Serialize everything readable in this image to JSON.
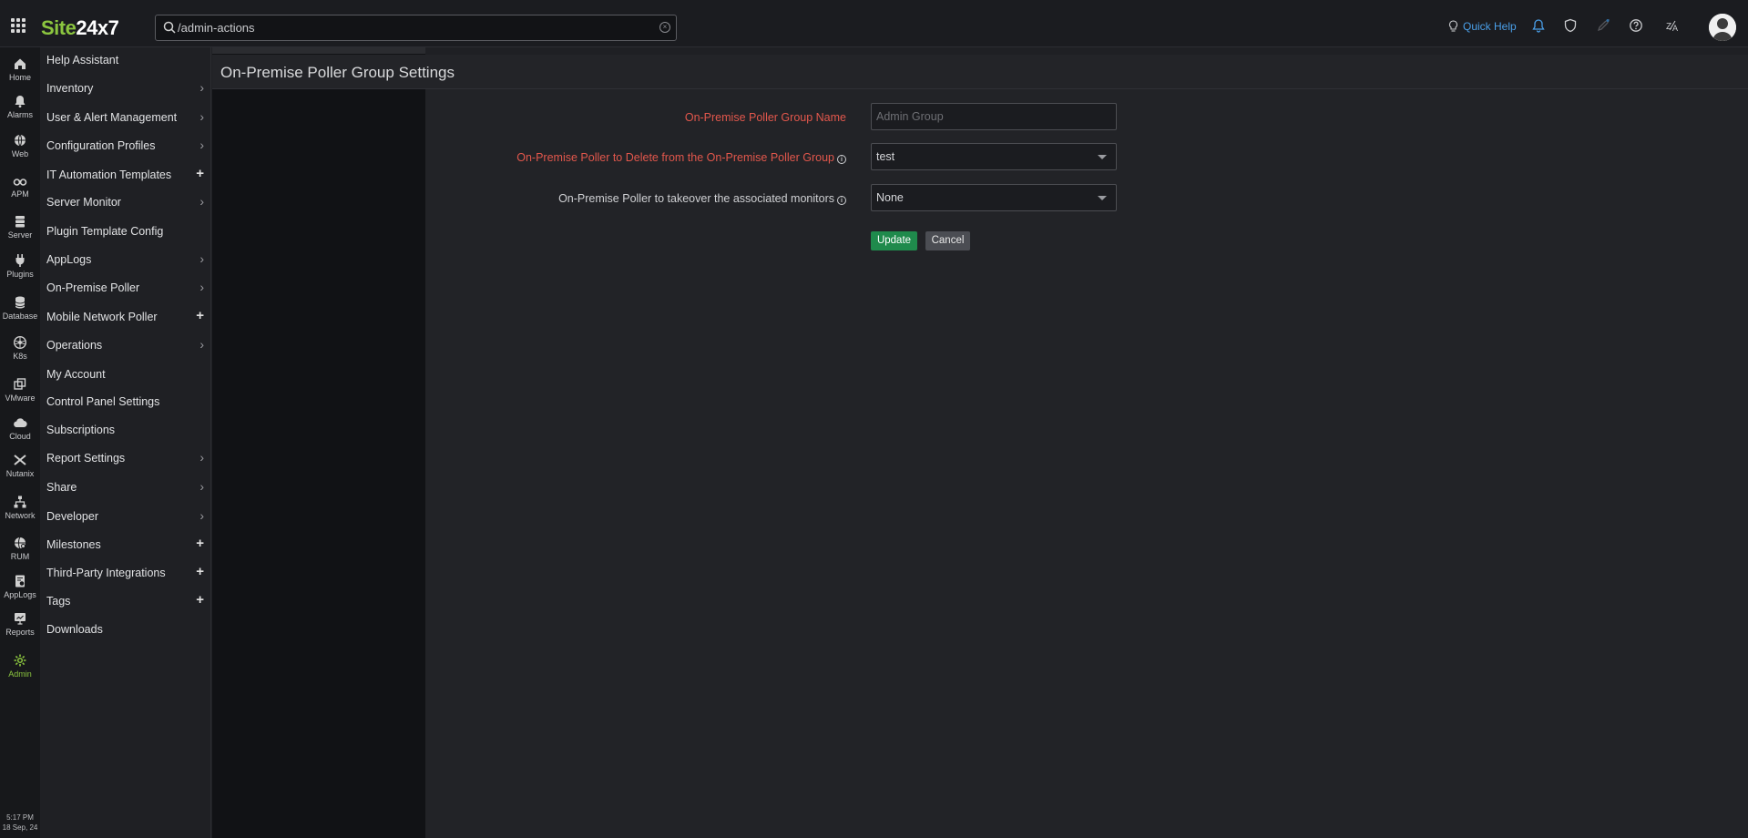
{
  "header": {
    "logo_part1": "Site",
    "logo_part2": "24x7",
    "search_value": "/admin-actions",
    "quick_help": "Quick Help",
    "icons": [
      "apps-grid-icon",
      "search-icon",
      "clear-icon",
      "lightbulb-icon",
      "bell-icon",
      "shield-icon",
      "rocket-icon",
      "help-icon",
      "translate-icon",
      "avatar"
    ]
  },
  "rail": {
    "items": [
      {
        "label": "Home",
        "icon": "home-icon"
      },
      {
        "label": "Alarms",
        "icon": "bell-icon"
      },
      {
        "label": "Web",
        "icon": "globe-icon"
      },
      {
        "label": "APM",
        "icon": "binoculars-icon"
      },
      {
        "label": "Server",
        "icon": "server-icon"
      },
      {
        "label": "Plugins",
        "icon": "plug-icon"
      },
      {
        "label": "Database",
        "icon": "database-icon"
      },
      {
        "label": "K8s",
        "icon": "kubernetes-icon"
      },
      {
        "label": "VMware",
        "icon": "vmware-icon"
      },
      {
        "label": "Cloud",
        "icon": "cloud-icon"
      },
      {
        "label": "Nutanix",
        "icon": "nutanix-icon"
      },
      {
        "label": "Network",
        "icon": "network-icon"
      },
      {
        "label": "RUM",
        "icon": "rum-icon"
      },
      {
        "label": "AppLogs",
        "icon": "applogs-icon"
      },
      {
        "label": "Reports",
        "icon": "reports-icon"
      },
      {
        "label": "Admin",
        "icon": "gear-icon"
      }
    ],
    "time": "5:17 PM",
    "date": "18 Sep, 24"
  },
  "menu": {
    "items": [
      {
        "label": "Help Assistant",
        "mark": ""
      },
      {
        "label": "Inventory",
        "mark": ">"
      },
      {
        "label": "User & Alert Management",
        "mark": ">"
      },
      {
        "label": "Configuration Profiles",
        "mark": ">"
      },
      {
        "label": "IT Automation Templates",
        "mark": "+"
      },
      {
        "label": "Server Monitor",
        "mark": ">"
      },
      {
        "label": "Plugin Template Config",
        "mark": ""
      },
      {
        "label": "AppLogs",
        "mark": ">"
      },
      {
        "label": "On-Premise Poller",
        "mark": ">"
      },
      {
        "label": "Mobile Network Poller",
        "mark": "+"
      },
      {
        "label": "Operations",
        "mark": ">"
      },
      {
        "label": "My Account",
        "mark": ""
      },
      {
        "label": "Control Panel Settings",
        "mark": ""
      },
      {
        "label": "Subscriptions",
        "mark": ""
      },
      {
        "label": "Report Settings",
        "mark": ">"
      },
      {
        "label": "Share",
        "mark": ">"
      },
      {
        "label": "Developer",
        "mark": ">"
      },
      {
        "label": "Milestones",
        "mark": "+"
      },
      {
        "label": "Third-Party Integrations",
        "mark": "+"
      },
      {
        "label": "Tags",
        "mark": "+"
      },
      {
        "label": "Downloads",
        "mark": ""
      }
    ]
  },
  "page": {
    "title": "On-Premise Poller Group Settings"
  },
  "form": {
    "group_name_label": "On-Premise Poller Group Name",
    "group_name_placeholder": "Admin Group",
    "group_name_value": "",
    "delete_label": "On-Premise Poller to Delete from the On-Premise Poller Group",
    "delete_value": "test",
    "takeover_label": "On-Premise Poller to takeover the associated monitors",
    "takeover_value": "None",
    "update_label": "Update",
    "cancel_label": "Cancel"
  },
  "colors": {
    "accent_green": "#8bc53f",
    "required_red": "#e2574c",
    "link_blue": "#4a9fe8",
    "update_button": "#1f8a4c"
  }
}
